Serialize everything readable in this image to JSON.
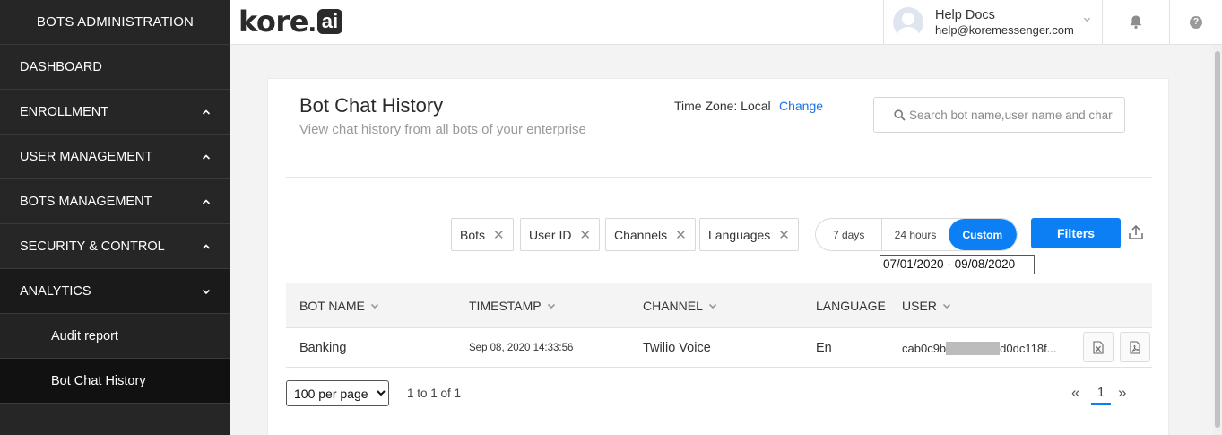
{
  "sidebar": {
    "header": "BOTS ADMINISTRATION",
    "items": [
      {
        "label": "DASHBOARD",
        "chevron": "none"
      },
      {
        "label": "ENROLLMENT",
        "chevron": "up"
      },
      {
        "label": "USER MANAGEMENT",
        "chevron": "up"
      },
      {
        "label": "BOTS MANAGEMENT",
        "chevron": "up"
      },
      {
        "label": "SECURITY & CONTROL",
        "chevron": "up"
      },
      {
        "label": "ANALYTICS",
        "chevron": "down"
      }
    ],
    "subitems": [
      {
        "label": "Audit report"
      },
      {
        "label": "Bot Chat History"
      }
    ]
  },
  "header": {
    "logo_text": "kore",
    "logo_dot": ".",
    "logo_badge": "ai",
    "user_name": "Help Docs",
    "user_email": "help@koremessenger.com",
    "icons": [
      "avatar",
      "chevron-down-icon",
      "bell-icon",
      "help-icon"
    ]
  },
  "page": {
    "title": "Bot Chat History",
    "subtitle": "View chat history from all bots of your enterprise",
    "timezone_label": "Time Zone: Local",
    "timezone_action": "Change",
    "search_placeholder": "Search bot name,user name and char"
  },
  "filters": {
    "chips": [
      "Bots",
      "User ID",
      "Channels",
      "Languages"
    ],
    "ranges": [
      "7 days",
      "24 hours",
      "Custom"
    ],
    "selected_range": "Custom",
    "date_range": "07/01/2020 - 09/08/2020",
    "filters_button": "Filters"
  },
  "table": {
    "columns": [
      "BOT NAME",
      "TIMESTAMP",
      "CHANNEL",
      "LANGUAGE",
      "USER"
    ],
    "rows": [
      {
        "bot_name": "Banking",
        "timestamp": "Sep 08, 2020 14:33:56",
        "channel": "Twilio Voice",
        "language": "En",
        "user_prefix": "cab0c9b",
        "user_suffix": "d0dc118f..."
      }
    ]
  },
  "pagination": {
    "per_page": "100 per page",
    "per_page_options": [
      "100 per page"
    ],
    "info": "1 to 1 of 1",
    "prev": "«",
    "current": "1",
    "next": "»"
  },
  "colors": {
    "sidebar_bg": "#262626",
    "accent": "#0d7ff5",
    "page_bg": "#f3f3f3"
  }
}
